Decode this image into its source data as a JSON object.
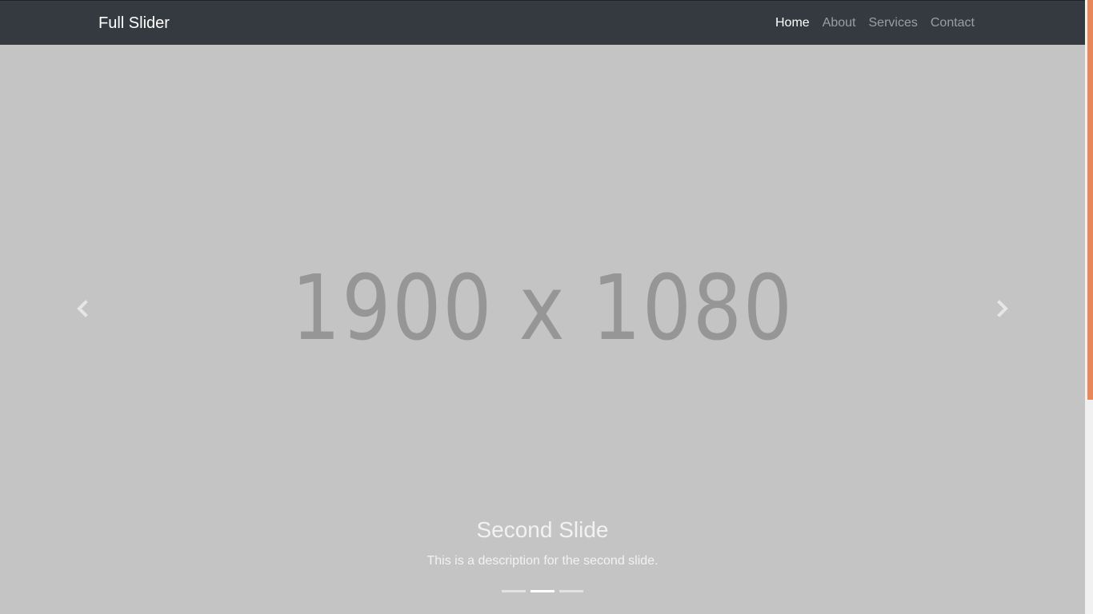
{
  "navbar": {
    "brand": "Full Slider",
    "links": [
      "Home",
      "About",
      "Services",
      "Contact"
    ],
    "active_link": "Home",
    "background": "#343a40"
  },
  "carousel": {
    "placeholder_text": "1900 x 1080",
    "background": "#c4c4c4",
    "caption": {
      "title": "Second Slide",
      "description": "This is a description for the second slide."
    },
    "indicators": {
      "count": 3,
      "active_index": 1
    },
    "prev_icon": "chevron-left-icon",
    "next_icon": "chevron-right-icon"
  },
  "scrollbar": {
    "thumb_color": "#e8875a"
  }
}
